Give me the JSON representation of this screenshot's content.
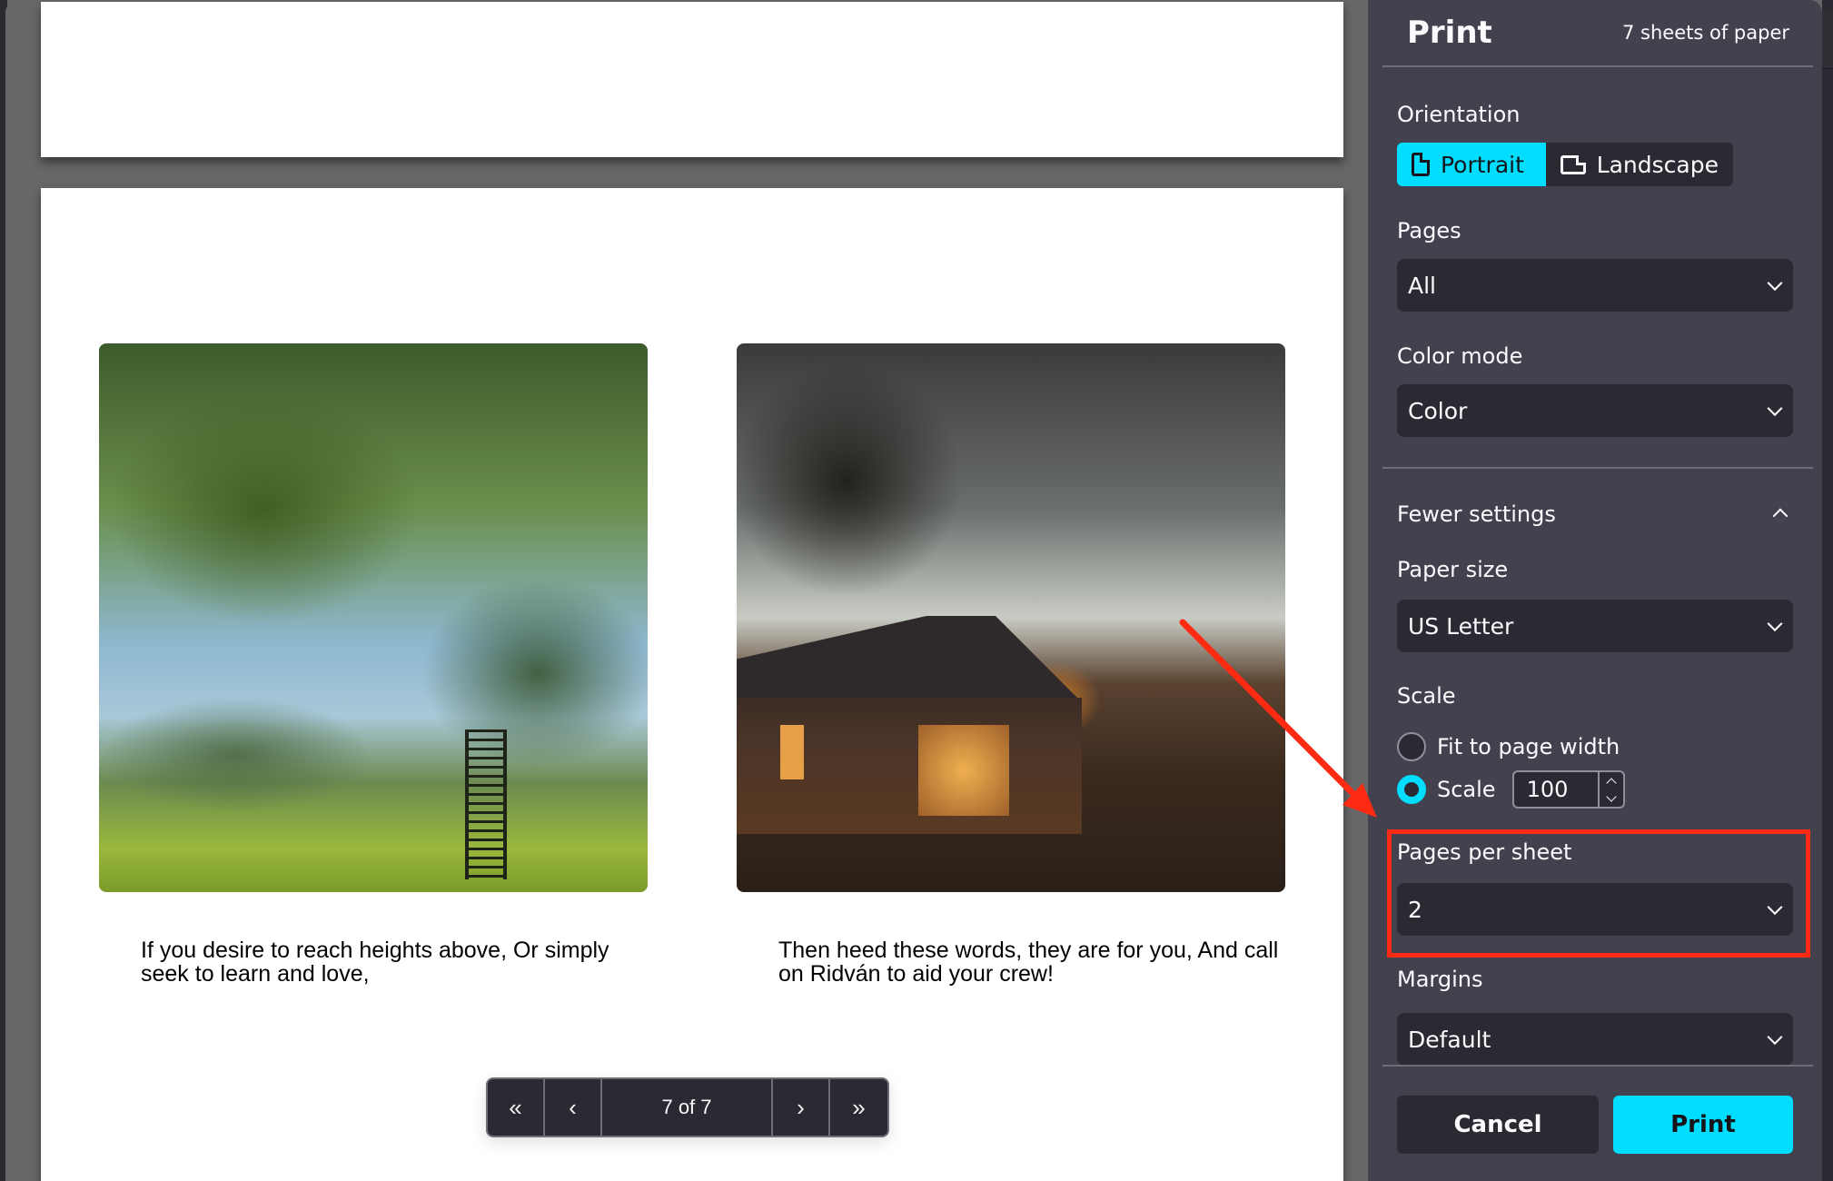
{
  "preview": {
    "pages": [
      {
        "caption": "If you desire to reach heights above, Or simply seek to learn and love,",
        "image": "painting-meadow-tree-ladder"
      },
      {
        "caption": "Then heed these words, they are for you, And call on Ridván to aid your crew!",
        "image": "painting-house-at-dusk"
      }
    ],
    "pager": {
      "first_icon": "«",
      "prev_icon": "‹",
      "status": "7 of 7",
      "next_icon": "›",
      "last_icon": "»"
    }
  },
  "print_panel": {
    "title": "Print",
    "sheet_count": "7 sheets of paper",
    "orientation": {
      "label": "Orientation",
      "options": [
        "Portrait",
        "Landscape"
      ],
      "selected": "Portrait"
    },
    "pages": {
      "label": "Pages",
      "value": "All"
    },
    "color_mode": {
      "label": "Color mode",
      "value": "Color"
    },
    "more_settings_toggle": "Fewer settings",
    "paper_size": {
      "label": "Paper size",
      "value": "US Letter"
    },
    "scale": {
      "label": "Scale",
      "fit_option": "Fit to page width",
      "scale_option": "Scale",
      "value": "100",
      "selected": "Scale"
    },
    "pages_per_sheet": {
      "label": "Pages per sheet",
      "value": "2"
    },
    "margins": {
      "label": "Margins",
      "value": "Default"
    },
    "buttons": {
      "cancel": "Cancel",
      "print": "Print"
    }
  },
  "colors": {
    "accent": "#00ddff",
    "panel_bg": "#42414d",
    "control_bg": "#2b2a33",
    "annotation": "#ff2a12"
  }
}
